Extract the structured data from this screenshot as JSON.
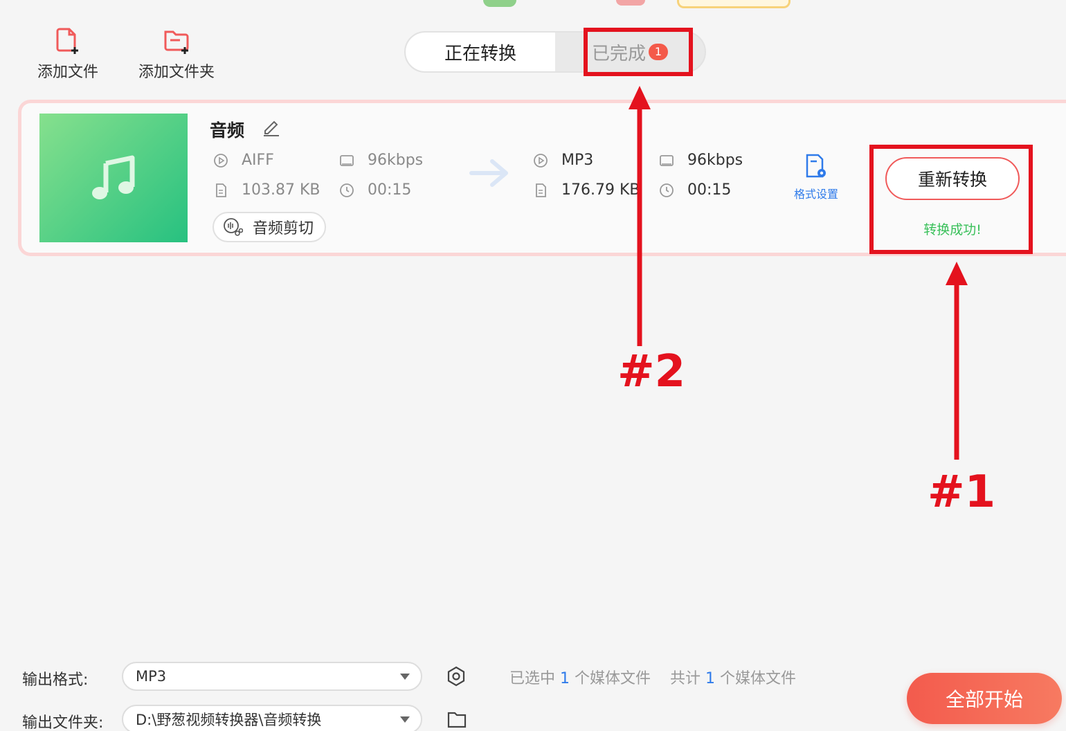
{
  "toolbar": {
    "add_file": "添加文件",
    "add_folder": "添加文件夹"
  },
  "tabs": {
    "converting": "正在转换",
    "completed": "已完成",
    "completed_badge": "1"
  },
  "file": {
    "name": "音频",
    "source": {
      "format": "AIFF",
      "bitrate": "96kbps",
      "size": "103.87 KB",
      "duration": "00:15"
    },
    "target": {
      "format": "MP3",
      "bitrate": "96kbps",
      "size": "176.79 KB",
      "duration": "00:15"
    },
    "cut_label": "音频剪切",
    "format_settings_label": "格式设置",
    "reconvert_label": "重新转换",
    "status_text": "转换成功!"
  },
  "annotations": {
    "one": "#1",
    "two": "#2",
    "color": "#e4121e"
  },
  "bottom": {
    "output_format_label": "输出格式:",
    "output_format_value": "MP3",
    "output_folder_label": "输出文件夹:",
    "output_folder_value": "D:\\野葱视频转换器\\音频转换",
    "selected_prefix": "已选中",
    "selected_count": "1",
    "selected_suffix": "个媒体文件",
    "total_prefix": "共计",
    "total_count": "1",
    "total_suffix": "个媒体文件",
    "start_all": "全部开始"
  },
  "colors": {
    "accent_red": "#f35b4d",
    "success_green": "#39c05a",
    "link_blue": "#2f7bea"
  }
}
